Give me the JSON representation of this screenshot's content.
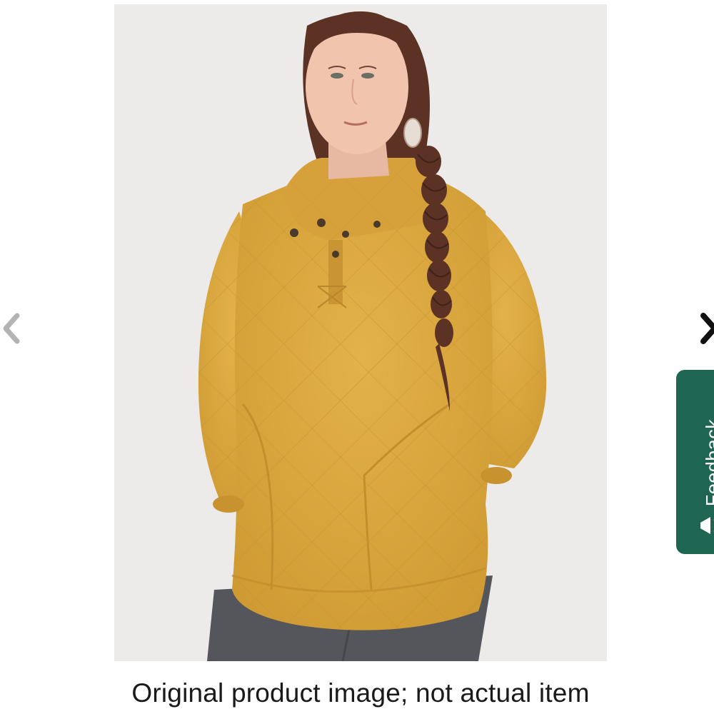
{
  "product": {
    "image_alt": "Woman wearing a mustard yellow quilted pullover with snap collar",
    "caption": "Original product image; not actual item"
  },
  "navigation": {
    "prev_icon": "chevron-left-icon",
    "next_icon": "chevron-right-icon"
  },
  "feedback": {
    "label": "Feedback",
    "icon": "megaphone-icon",
    "color": "#1e6651"
  },
  "colors": {
    "garment": "#d9a53b",
    "background": "#ecebea",
    "pants": "#55565b",
    "arrow_prev": "#b3b3b3",
    "arrow_next": "#111111"
  }
}
